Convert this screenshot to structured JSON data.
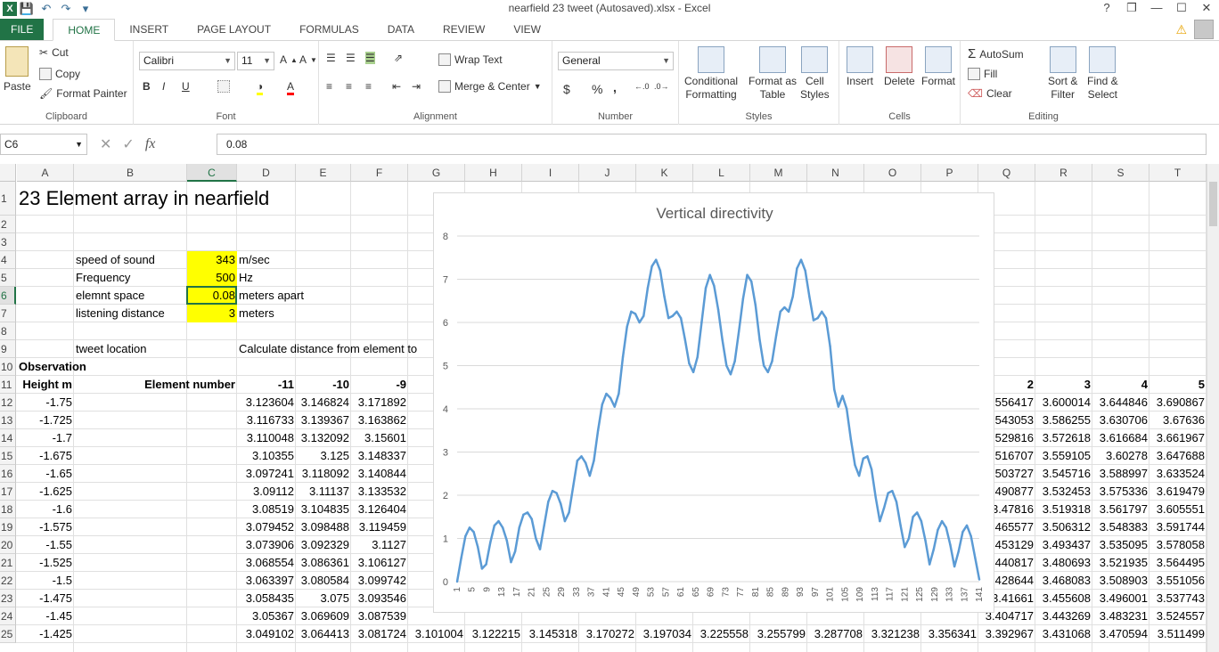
{
  "titlebar": {
    "title": "nearfield 23 tweet (Autosaved).xlsx - Excel",
    "app_icon": "X",
    "qat": [
      "save-icon",
      "undo-icon",
      "redo-icon",
      "customize-icon"
    ],
    "controls": [
      "?",
      "❐",
      "—",
      "☐",
      "✕"
    ]
  },
  "tabs": [
    "FILE",
    "HOME",
    "INSERT",
    "PAGE LAYOUT",
    "FORMULAS",
    "DATA",
    "REVIEW",
    "VIEW"
  ],
  "active_tab": "HOME",
  "ribbon": {
    "clipboard": {
      "paste": "Paste",
      "cut": "Cut",
      "copy": "Copy",
      "format_painter": "Format Painter",
      "label": "Clipboard"
    },
    "font": {
      "name": "Calibri",
      "size": "11",
      "bold": "B",
      "italic": "I",
      "underline": "U",
      "label": "Font"
    },
    "alignment": {
      "wrap": "Wrap Text",
      "merge": "Merge & Center",
      "label": "Alignment"
    },
    "number": {
      "format": "General",
      "currency": "$",
      "percent": "%",
      "comma": ",",
      "label": "Number"
    },
    "styles": {
      "conditional": [
        "Conditional",
        "Formatting"
      ],
      "format_table": [
        "Format as",
        "Table"
      ],
      "cell_styles": [
        "Cell",
        "Styles"
      ],
      "label": "Styles"
    },
    "cells": {
      "insert": "Insert",
      "delete": "Delete",
      "format": "Format",
      "label": "Cells"
    },
    "editing": {
      "autosum": "AutoSum",
      "fill": "Fill",
      "clear": "Clear",
      "sort": [
        "Sort &",
        "Filter"
      ],
      "find": [
        "Find &",
        "Select"
      ],
      "label": "Editing"
    }
  },
  "formula_bar": {
    "name_box": "C6",
    "fx": "fx",
    "value": "0.08"
  },
  "columns": [
    "A",
    "B",
    "C",
    "D",
    "E",
    "F",
    "G",
    "H",
    "I",
    "J",
    "K",
    "L",
    "M",
    "N",
    "O",
    "P",
    "Q",
    "R",
    "S",
    "T"
  ],
  "selected_column": "C",
  "rows": [
    1,
    2,
    3,
    4,
    5,
    6,
    7,
    8,
    9,
    10,
    11,
    12,
    13,
    14,
    15,
    16,
    17,
    18,
    19,
    20,
    21,
    22,
    23,
    24,
    25
  ],
  "selected_row": 6,
  "cells": {
    "title": "23 Element array in nearfield",
    "r4": {
      "b": "speed of sound",
      "c": "343",
      "d": "m/sec"
    },
    "r5": {
      "b": "Frequency",
      "c": "500",
      "d": "Hz"
    },
    "r6": {
      "b": "elemnt space",
      "c": "0.08",
      "d": "meters apart"
    },
    "r7": {
      "b": "listening distance",
      "c": "3",
      "d": "meters"
    },
    "r9": {
      "b": "tweet location",
      "d": "Calculate distance from element to"
    },
    "r10": {
      "a": "Observation"
    },
    "r11": {
      "a": "Height m",
      "bc": "Element number",
      "d": "-11",
      "e": "-10",
      "f": "-9",
      "q": "2",
      "r": "3",
      "s": "4",
      "t": "5"
    }
  },
  "table_rows": [
    {
      "a": "-1.75",
      "d": "3.123604",
      "e": "3.146824",
      "f": "3.171892",
      "q": "556417",
      "r": "3.600014",
      "s": "3.644846",
      "t": "3.690867"
    },
    {
      "a": "-1.725",
      "d": "3.116733",
      "e": "3.139367",
      "f": "3.163862",
      "q": "543053",
      "r": "3.586255",
      "s": "3.630706",
      "t": "3.67636"
    },
    {
      "a": "-1.7",
      "d": "3.110048",
      "e": "3.132092",
      "f": "3.15601",
      "q": "529816",
      "r": "3.572618",
      "s": "3.616684",
      "t": "3.661967"
    },
    {
      "a": "-1.675",
      "d": "3.10355",
      "e": "3.125",
      "f": "3.148337",
      "q": "516707",
      "r": "3.559105",
      "s": "3.60278",
      "t": "3.647688"
    },
    {
      "a": "-1.65",
      "d": "3.097241",
      "e": "3.118092",
      "f": "3.140844",
      "q": "503727",
      "r": "3.545716",
      "s": "3.588997",
      "t": "3.633524"
    },
    {
      "a": "-1.625",
      "d": "3.09112",
      "e": "3.11137",
      "f": "3.133532",
      "q": "490877",
      "r": "3.532453",
      "s": "3.575336",
      "t": "3.619479"
    },
    {
      "a": "-1.6",
      "d": "3.08519",
      "e": "3.104835",
      "f": "3.126404",
      "q": "3.47816",
      "r": "3.519318",
      "s": "3.561797",
      "t": "3.605551"
    },
    {
      "a": "-1.575",
      "d": "3.079452",
      "e": "3.098488",
      "f": "3.119459",
      "q": "465577",
      "r": "3.506312",
      "s": "3.548383",
      "t": "3.591744"
    },
    {
      "a": "-1.55",
      "d": "3.073906",
      "e": "3.092329",
      "f": "3.1127",
      "q": "453129",
      "r": "3.493437",
      "s": "3.535095",
      "t": "3.578058"
    },
    {
      "a": "-1.525",
      "d": "3.068554",
      "e": "3.086361",
      "f": "3.106127",
      "q": "440817",
      "r": "3.480693",
      "s": "3.521935",
      "t": "3.564495"
    },
    {
      "a": "-1.5",
      "d": "3.063397",
      "e": "3.080584",
      "f": "3.099742",
      "q": "428644",
      "r": "3.468083",
      "s": "3.508903",
      "t": "3.551056"
    },
    {
      "a": "-1.475",
      "d": "3.058435",
      "e": "3.075",
      "f": "3.093546",
      "q": "3.41661",
      "r": "3.455608",
      "s": "3.496001",
      "t": "3.537743"
    },
    {
      "a": "-1.45",
      "d": "3.05367",
      "e": "3.069609",
      "f": "3.087539",
      "q": "3.404717",
      "r": "3.443269",
      "s": "3.483231",
      "t": "3.524557"
    },
    {
      "a": "-1.425",
      "d": "3.049102",
      "e": "3.064413",
      "f": "3.081724",
      "g": "3.101004",
      "h": "3.122215",
      "i": "3.145318",
      "j": "3.170272",
      "k": "3.197034",
      "l": "3.225558",
      "m": "3.255799",
      "n": "3.287708",
      "o": "3.321238",
      "p": "3.356341",
      "q": "3.392967",
      "r": "3.431068",
      "s": "3.470594",
      "t": "3.511499"
    }
  ],
  "colors": {
    "accent": "#217346",
    "highlight": "#ffff00",
    "series": "#5b9bd5"
  },
  "chart_data": {
    "type": "line",
    "title": "Vertical directivity",
    "xlabel": "",
    "ylabel": "",
    "ylim": [
      0,
      8
    ],
    "yticks": [
      "0",
      "1",
      "2",
      "3",
      "4",
      "5",
      "6",
      "7",
      "8"
    ],
    "x_start": 1,
    "x_end": 141,
    "xtick_labels": [
      "1",
      "5",
      "9",
      "13",
      "17",
      "21",
      "25",
      "29",
      "33",
      "37",
      "41",
      "45",
      "49",
      "53",
      "57",
      "61",
      "65",
      "69",
      "73",
      "77",
      "81",
      "85",
      "89",
      "93",
      "97",
      "101",
      "105",
      "109",
      "113",
      "117",
      "121",
      "125",
      "129",
      "133",
      "137",
      "141"
    ],
    "grid": true,
    "legend": "none",
    "series": [
      {
        "values": [
          0.0,
          0.55,
          1.05,
          1.25,
          1.15,
          0.8,
          0.3,
          0.4,
          0.9,
          1.3,
          1.4,
          1.25,
          0.95,
          0.45,
          0.7,
          1.25,
          1.55,
          1.6,
          1.45,
          1.0,
          0.75,
          1.3,
          1.85,
          2.1,
          2.05,
          1.8,
          1.4,
          1.6,
          2.2,
          2.8,
          2.9,
          2.75,
          2.45,
          2.8,
          3.5,
          4.1,
          4.35,
          4.25,
          4.05,
          4.35,
          5.2,
          5.9,
          6.25,
          6.2,
          6.0,
          6.15,
          6.8,
          7.3,
          7.45,
          7.2,
          6.6,
          6.1,
          6.15,
          6.25,
          6.1,
          5.6,
          5.05,
          4.85,
          5.2,
          6.0,
          6.8,
          7.1,
          6.85,
          6.3,
          5.6,
          5.0,
          4.8,
          5.1,
          5.8,
          6.55,
          7.1,
          6.95,
          6.4,
          5.6,
          5.0,
          4.85,
          5.1,
          5.7,
          6.25,
          6.35,
          6.25,
          6.6,
          7.25,
          7.45,
          7.2,
          6.6,
          6.05,
          6.1,
          6.25,
          6.1,
          5.45,
          4.45,
          4.05,
          4.3,
          4.0,
          3.3,
          2.7,
          2.45,
          2.85,
          2.9,
          2.6,
          1.95,
          1.4,
          1.7,
          2.05,
          2.1,
          1.85,
          1.3,
          0.8,
          1.0,
          1.5,
          1.6,
          1.4,
          0.95,
          0.4,
          0.75,
          1.2,
          1.4,
          1.25,
          0.85,
          0.35,
          0.7,
          1.15,
          1.3,
          1.05,
          0.55,
          0.05
        ]
      }
    ]
  }
}
